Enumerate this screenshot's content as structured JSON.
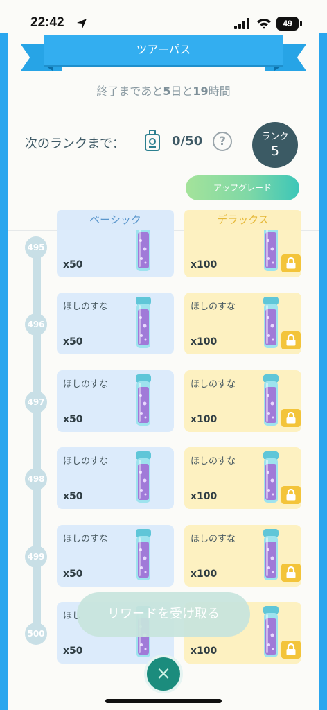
{
  "status_bar": {
    "time": "22:42",
    "battery": "49"
  },
  "header": {
    "title": "ツアーパス"
  },
  "remaining": {
    "prefix": "終了まであと",
    "days": "5",
    "mid": "日と",
    "hours": "19",
    "suffix": "時間"
  },
  "progress": {
    "label": "次のランクまで：",
    "value": "0/50",
    "help": "?"
  },
  "rank": {
    "label": "ランク",
    "value": "5"
  },
  "upgrade_button": "アップグレード",
  "columns": {
    "basic": "ベーシック",
    "deluxe": "デラックス"
  },
  "rows": [
    {
      "rank": "495",
      "basic": {
        "name": "",
        "qty": "x50"
      },
      "deluxe": {
        "name": "",
        "qty": "x100"
      }
    },
    {
      "rank": "496",
      "basic": {
        "name": "ほしのすな",
        "qty": "x50"
      },
      "deluxe": {
        "name": "ほしのすな",
        "qty": "x100"
      }
    },
    {
      "rank": "497",
      "basic": {
        "name": "ほしのすな",
        "qty": "x50"
      },
      "deluxe": {
        "name": "ほしのすな",
        "qty": "x100"
      }
    },
    {
      "rank": "498",
      "basic": {
        "name": "ほしのすな",
        "qty": "x50"
      },
      "deluxe": {
        "name": "ほしのすな",
        "qty": "x100"
      }
    },
    {
      "rank": "499",
      "basic": {
        "name": "ほしのすな",
        "qty": "x50"
      },
      "deluxe": {
        "name": "ほしのすな",
        "qty": "x100"
      }
    },
    {
      "rank": "500",
      "basic": {
        "name": "ほし",
        "qty": "x50"
      },
      "deluxe": {
        "name": "",
        "qty": "x100"
      }
    }
  ],
  "reward_button": "リワードを受け取る",
  "close_button": "×",
  "icons": {
    "location": "location-arrow-icon",
    "signal": "signal-icon",
    "wifi": "wifi-icon",
    "ticket": "ticket-icon",
    "vial": "stardust-vial-icon",
    "lock": "lock-icon",
    "close": "close-icon"
  },
  "colors": {
    "accent": "#2aa6ee",
    "basic": "#dcebfb",
    "deluxe": "#fdf1c1",
    "lock": "#f3c43a",
    "rank_badge": "#3b5a64"
  }
}
